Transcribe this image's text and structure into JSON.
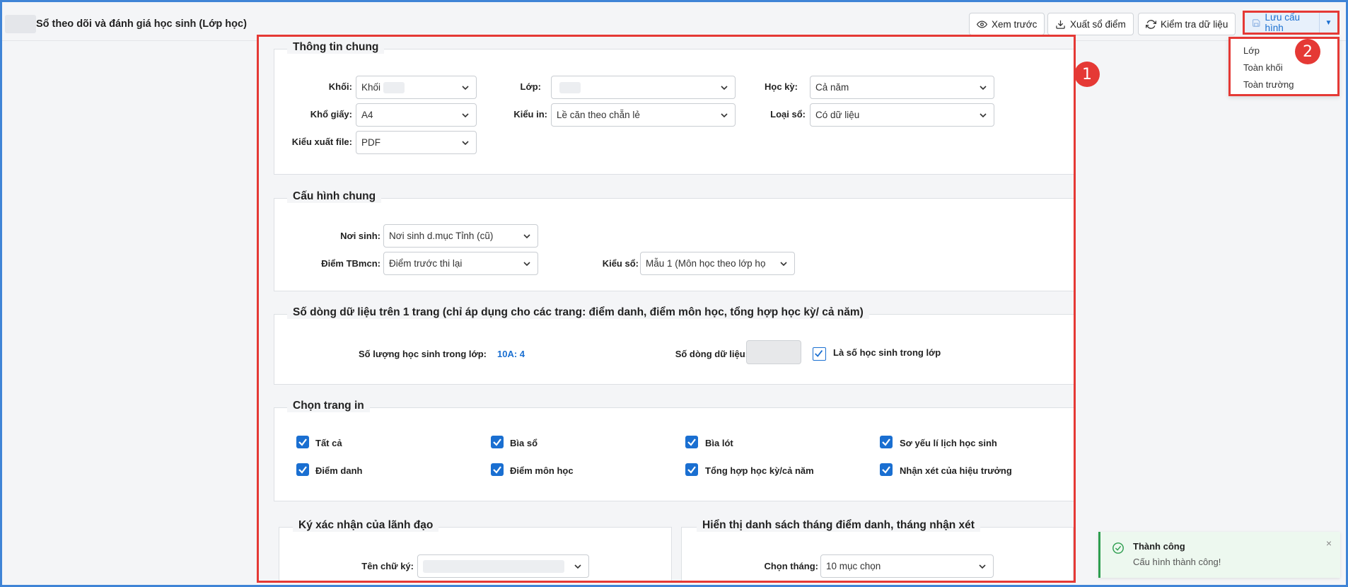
{
  "header": {
    "title": "Sổ theo dõi và đánh giá học sinh (Lớp học)",
    "buttons": {
      "preview": "Xem trước",
      "export": "Xuất sổ điểm",
      "check": "Kiểm tra dữ liệu",
      "save": "Lưu cấu hình"
    }
  },
  "save_menu": {
    "items": [
      "Lớp",
      "Toàn khối",
      "Toàn trường"
    ]
  },
  "badges": {
    "panel": "1",
    "menu": "2"
  },
  "general_info": {
    "title": "Thông tin chung",
    "khoi_label": "Khối:",
    "khoi_value": "Khối",
    "lop_label": "Lớp:",
    "lop_value": "",
    "hocky_label": "Học kỳ:",
    "hocky_value": "Cả năm",
    "khogiay_label": "Khổ giấy:",
    "khogiay_value": "A4",
    "kieuin_label": "Kiểu in:",
    "kieuin_value": "Lề căn theo chẵn lẻ",
    "loaiso_label": "Loại sổ:",
    "loaiso_value": "Có dữ liệu",
    "kieuxuat_label": "Kiểu xuất file:",
    "kieuxuat_value": "PDF"
  },
  "general_config": {
    "title": "Cấu hình chung",
    "noisinh_label": "Nơi sinh:",
    "noisinh_value": "Nơi sinh d.mục Tỉnh (cũ)",
    "diemtb_label": "Điểm TBmcn:",
    "diemtb_value": "Điểm trước thi lại",
    "kieuso_label": "Kiểu sổ:",
    "kieuso_value": "Mẫu 1 (Môn học theo lớp họ"
  },
  "rows_per_page": {
    "title": "Số dòng dữ liệu trên 1 trang (chỉ áp dụng cho các trang: điểm danh, điểm môn học, tổng hợp học kỳ/ cả năm)",
    "count_label": "Số lượng học sinh trong lớp:",
    "count_value": "10A: 4",
    "rows_label": "Số dòng dữ liệu:",
    "is_class_label": "Là số học sinh trong lớp"
  },
  "print_pages": {
    "title": "Chọn trang in",
    "items": [
      "Tất cả",
      "Bìa sổ",
      "Bìa lót",
      "Sơ yếu lí lịch học sinh",
      "Điểm danh",
      "Điểm môn học",
      "Tổng hợp học kỳ/cả năm",
      "Nhận xét của hiệu trưởng"
    ]
  },
  "leader_sign": {
    "title": "Ký xác nhận của lãnh đạo",
    "name_label": "Tên chữ ký:"
  },
  "month_display": {
    "title": "Hiển thị danh sách tháng điểm danh, tháng nhận xét",
    "month_label": "Chọn tháng:",
    "month_value": "10 mục chọn"
  },
  "toast": {
    "title": "Thành công",
    "message": "Cấu hình thành công!",
    "close": "×"
  },
  "colors": {
    "accent": "#1a6fd1",
    "highlight": "#e53935",
    "success": "#2e9e4f"
  }
}
